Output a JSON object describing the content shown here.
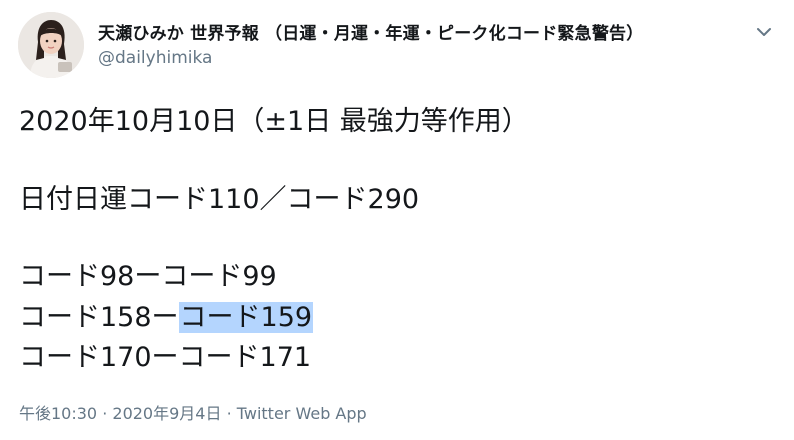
{
  "author": {
    "display_name": "天瀬ひみか 世界予報 （日運・月運・年運・ピーク化コード緊急警告）",
    "handle": "@dailyhimika",
    "avatar_icon": "profile-photo-avatar",
    "menu_icon": "chevron-down-icon"
  },
  "tweet": {
    "line1": "2020年10月10日（±1日 最強力等作用）",
    "line2": "日付日運コード110／コード290",
    "line3": "コード98ーコード99",
    "line4_a": "コード158ー",
    "line4_b": "コード159",
    "line5": "コード170ーコード171"
  },
  "meta": {
    "time": "午後10:30",
    "sep1": " · ",
    "date": "2020年9月4日",
    "sep2": " · ",
    "source": "Twitter Web App"
  },
  "colors": {
    "text": "#14171a",
    "secondary": "#657786",
    "selection": "#b4d5fe"
  }
}
